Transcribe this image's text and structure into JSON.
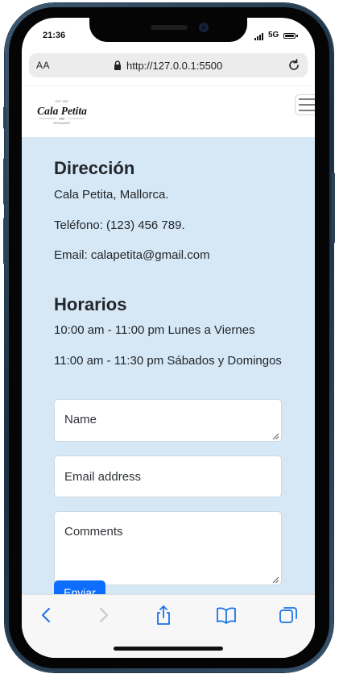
{
  "status_bar": {
    "time": "21:36",
    "network": "5G",
    "battery_level": 1.0
  },
  "browser": {
    "text_size_label": "AA",
    "url": "http://127.0.0.1:5500"
  },
  "header": {
    "logo_text": "Cala Petita",
    "logo_upper": "EST 1987",
    "logo_mid": "BAR",
    "logo_lower": "RESTAURANT"
  },
  "direccion": {
    "heading": "Dirección",
    "address": "Cala Petita, Mallorca.",
    "phone": "Teléfono: (123) 456 789.",
    "email": "Email: calapetita@gmail.com"
  },
  "horarios": {
    "heading": "Horarios",
    "weekdays": "10:00 am - 11:00 pm Lunes a Viernes",
    "weekend": "11:00 am - 11:30 pm Sábados y Domingos"
  },
  "form": {
    "name_placeholder": "Name",
    "email_placeholder": "Email address",
    "comments_placeholder": "Comments",
    "submit_label": "Enviar"
  },
  "colors": {
    "content_bg": "#d6e8f6",
    "accent": "#0d6efd",
    "toolbar_icon": "#1a73e8"
  },
  "icons": [
    "lock-icon",
    "reload-icon",
    "hamburger-icon",
    "back-icon",
    "forward-icon",
    "share-icon",
    "bookmarks-icon",
    "tabs-icon"
  ]
}
